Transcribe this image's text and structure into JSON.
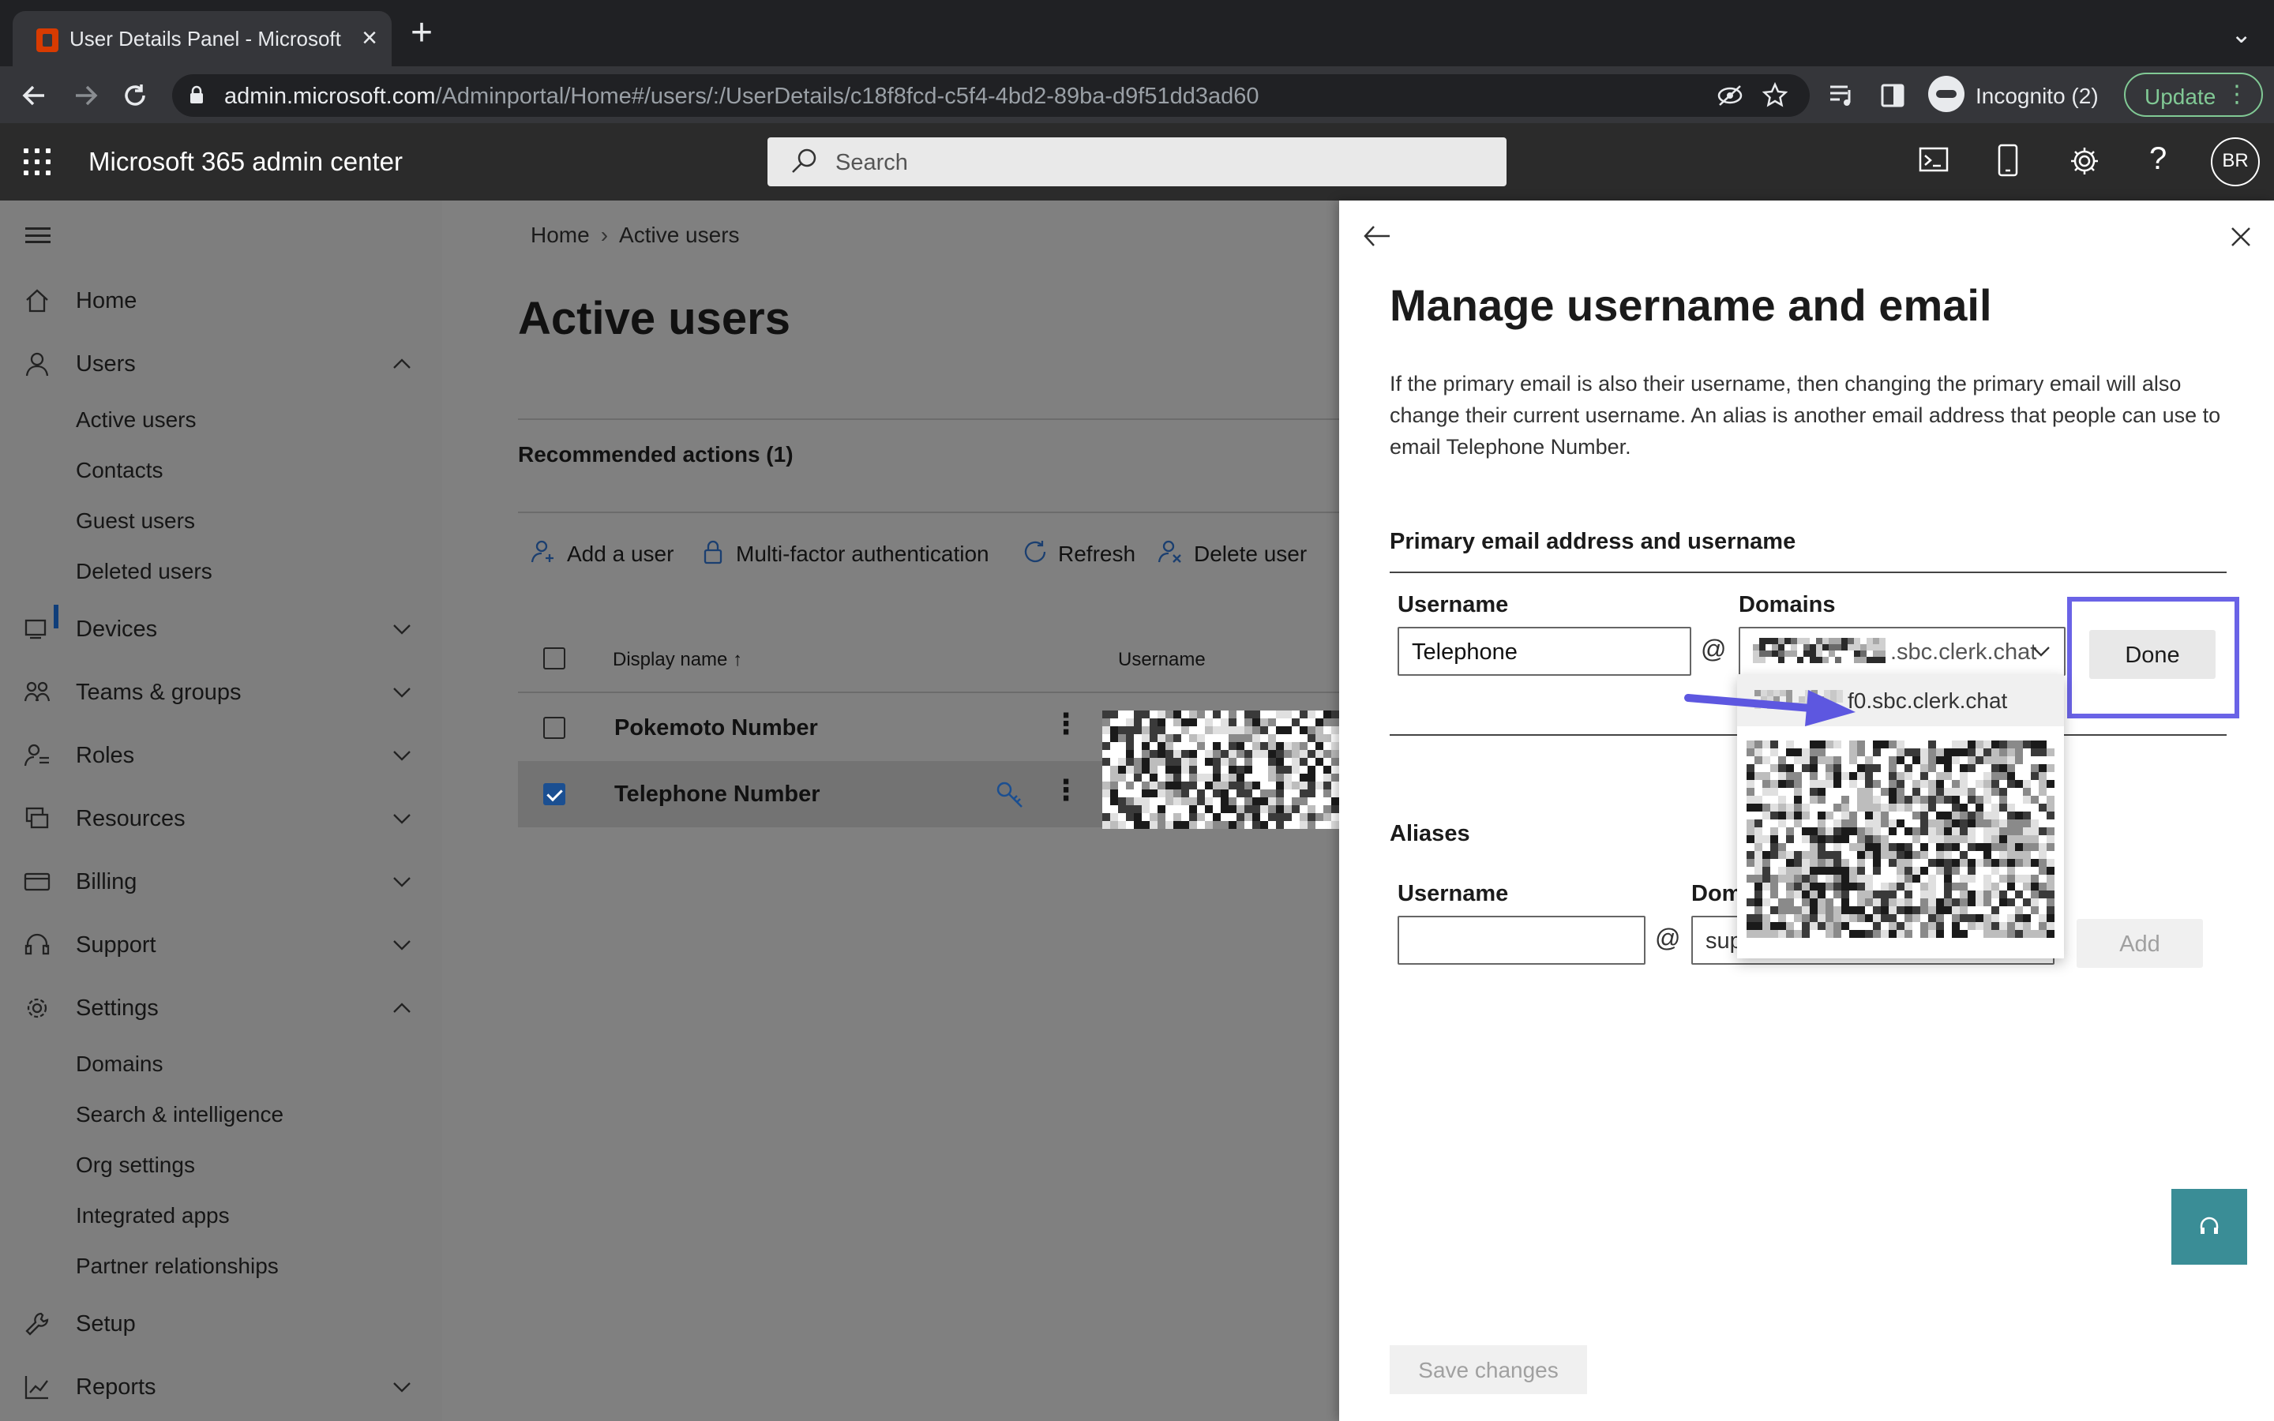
{
  "browser": {
    "tab_title": "User Details Panel - Microsoft",
    "url_domain": "admin.microsoft.com",
    "url_path": "/Adminportal/Home#/users/:/UserDetails/c18f8fcd-c5f4-4bd2-89ba-d9f51dd3ad60",
    "incognito_label": "Incognito (2)",
    "update_label": "Update"
  },
  "header": {
    "app_title": "Microsoft 365 admin center",
    "search_placeholder": "Search",
    "avatar_initials": "BR"
  },
  "sidebar": {
    "items": [
      {
        "label": "Home",
        "icon": "home-icon"
      },
      {
        "label": "Users",
        "icon": "user-icon",
        "expanded": true
      },
      {
        "label": "Devices",
        "icon": "devices-icon"
      },
      {
        "label": "Teams & groups",
        "icon": "teams-icon"
      },
      {
        "label": "Roles",
        "icon": "roles-icon"
      },
      {
        "label": "Resources",
        "icon": "resources-icon"
      },
      {
        "label": "Billing",
        "icon": "billing-icon"
      },
      {
        "label": "Support",
        "icon": "headset-icon"
      },
      {
        "label": "Settings",
        "icon": "gear-icon",
        "expanded": true
      },
      {
        "label": "Setup",
        "icon": "wrench-icon"
      },
      {
        "label": "Reports",
        "icon": "chart-icon"
      }
    ],
    "users_sub": [
      "Active users",
      "Contacts",
      "Guest users",
      "Deleted users"
    ],
    "settings_sub": [
      "Domains",
      "Search & intelligence",
      "Org settings",
      "Integrated apps",
      "Partner relationships"
    ]
  },
  "main": {
    "breadcrumb": [
      "Home",
      "Active users"
    ],
    "title": "Active users",
    "recommended": "Recommended actions (1)",
    "commands": [
      "Add a user",
      "Multi-factor authentication",
      "Refresh",
      "Delete user"
    ],
    "columns": [
      "Display name",
      "Username"
    ],
    "rows": [
      {
        "name": "Pokemoto Number",
        "selected": false
      },
      {
        "name": "Telephone Number",
        "selected": true
      }
    ]
  },
  "panel": {
    "title": "Manage username and email",
    "description": "If the primary email is also their username, then changing the primary email will also change their current username. An alias is another email address that people can use to email Telephone Number.",
    "primary_section": "Primary email address and username",
    "username_label": "Username",
    "username_value": "Telephone",
    "at_symbol": "@",
    "domains_label": "Domains",
    "domain_value_suffix": ".sbc.clerk.chat",
    "dropdown_option_visible": "f0.sbc.clerk.chat",
    "done_label": "Done",
    "aliases_section": "Aliases",
    "alias_username_label": "Username",
    "alias_domains_label_visible": "Dom",
    "alias_domain_value_visible": "sup",
    "add_label": "Add",
    "save_label": "Save changes"
  },
  "colors": {
    "highlight_outline": "#6a63e6",
    "arrow": "#5d57e0",
    "help_fab": "#3a8d96",
    "checkbox_checked": "#1b4f91"
  }
}
